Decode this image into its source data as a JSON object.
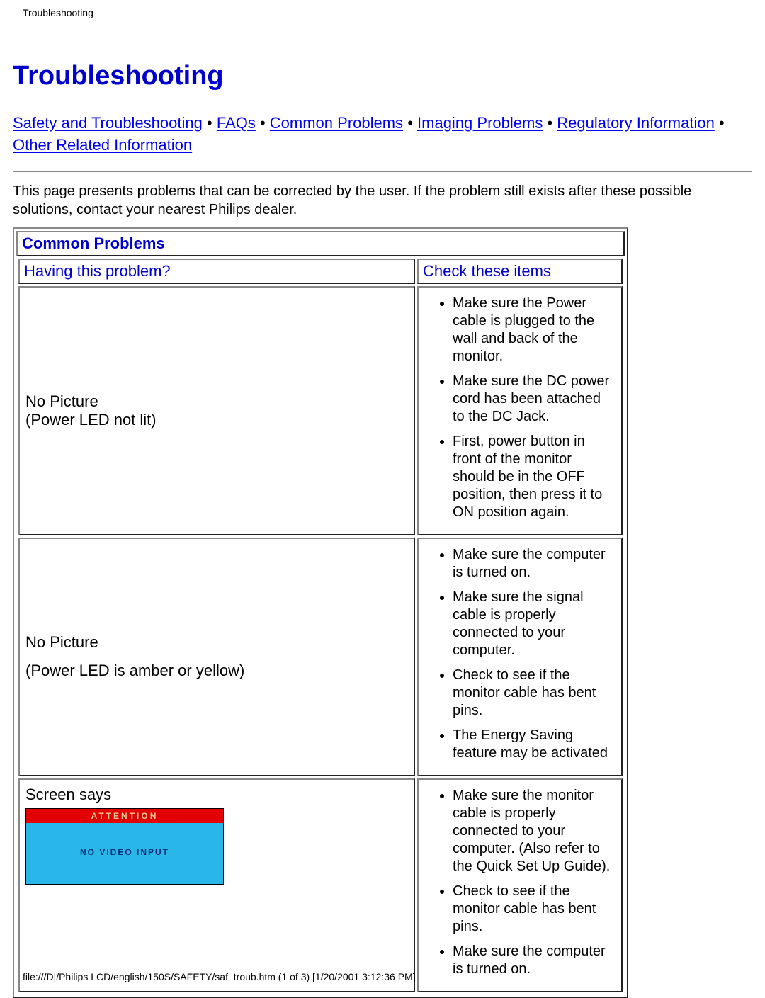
{
  "header_small": "Troubleshooting",
  "title": "Troubleshooting",
  "nav": {
    "links": [
      "Safety and Troubleshooting",
      "FAQs",
      "Common Problems",
      "Imaging Problems",
      "Regulatory Information",
      "Other Related Information"
    ],
    "sep": " • "
  },
  "intro": "This page presents problems that can be corrected by the user. If the problem still exists after these possible solutions, contact your nearest Philips dealer.",
  "section_title": "Common Problems",
  "col_headers": {
    "left": "Having this problem?",
    "right": "Check these items"
  },
  "rows": [
    {
      "problem_line1": "No Picture",
      "problem_line2": "(Power LED not lit)",
      "checks": [
        "Make sure the Power cable is plugged to the wall and back of the monitor.",
        "Make sure the DC power cord has been attached to the DC Jack.",
        "First, power button in front of the monitor should be in the OFF position, then press it to ON position again."
      ]
    },
    {
      "problem_line1": "No Picture",
      "problem_line2": "(Power LED is amber or yellow)",
      "checks": [
        "Make sure the computer is turned on.",
        "Make sure the signal cable is properly connected to your computer.",
        "Check to see if the monitor cable has bent pins.",
        "The Energy Saving feature may be activated"
      ]
    },
    {
      "problem_line1": "Screen says",
      "screen_attn": "ATTENTION",
      "screen_body": "NO VIDEO INPUT",
      "checks": [
        "Make sure the monitor cable is properly connected to your computer. (Also refer to the Quick Set Up Guide).",
        "Check to see if the monitor cable has bent pins.",
        "Make sure the computer is turned on."
      ]
    }
  ],
  "footer": "file:///D|/Philips LCD/english/150S/SAFETY/saf_troub.htm (1 of 3) [1/20/2001 3:12:36 PM]"
}
